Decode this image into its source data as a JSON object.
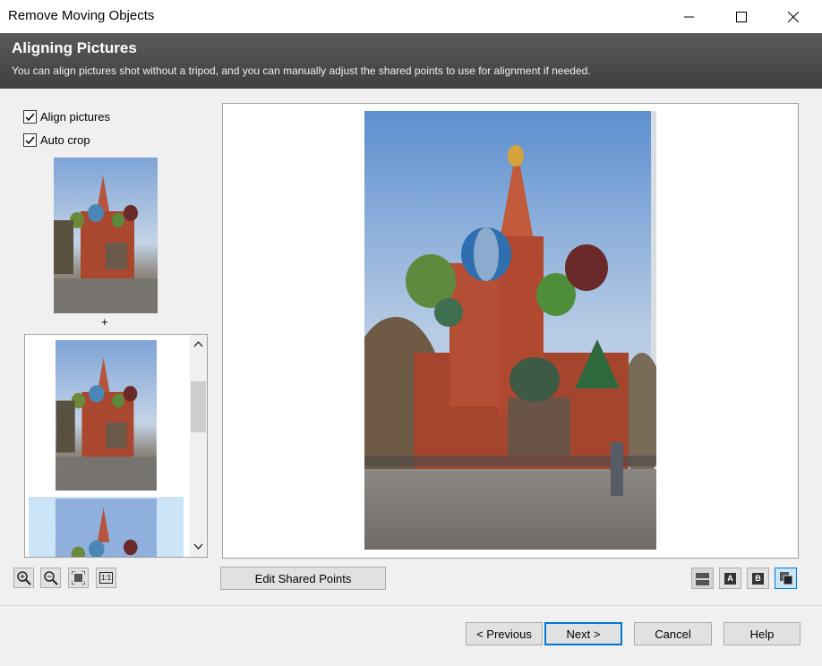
{
  "window": {
    "title": "Remove Moving Objects"
  },
  "header": {
    "title": "Aligning Pictures",
    "subtitle": "You can align pictures shot without a tripod, and you can manually adjust the shared points to use for alignment if needed."
  },
  "options": {
    "align_pictures": {
      "label": "Align pictures",
      "checked": true
    },
    "auto_crop": {
      "label": "Auto crop",
      "checked": true
    }
  },
  "plus_label": "+",
  "toolbar": {
    "zoom_in_icon": "zoom-in-icon",
    "zoom_out_icon": "zoom-out-icon",
    "fit_icon": "fit-to-window-icon",
    "actual_size_label": "1:1",
    "edit_shared_points_label": "Edit Shared Points",
    "view_a_label": "A",
    "view_b_label": "B"
  },
  "footer": {
    "previous_label": "< Previous",
    "next_label": "Next >",
    "cancel_label": "Cancel",
    "help_label": "Help"
  },
  "colors": {
    "banner": "#4a4a4a",
    "selection": "#cce4f7",
    "focus_border": "#0078d7"
  }
}
